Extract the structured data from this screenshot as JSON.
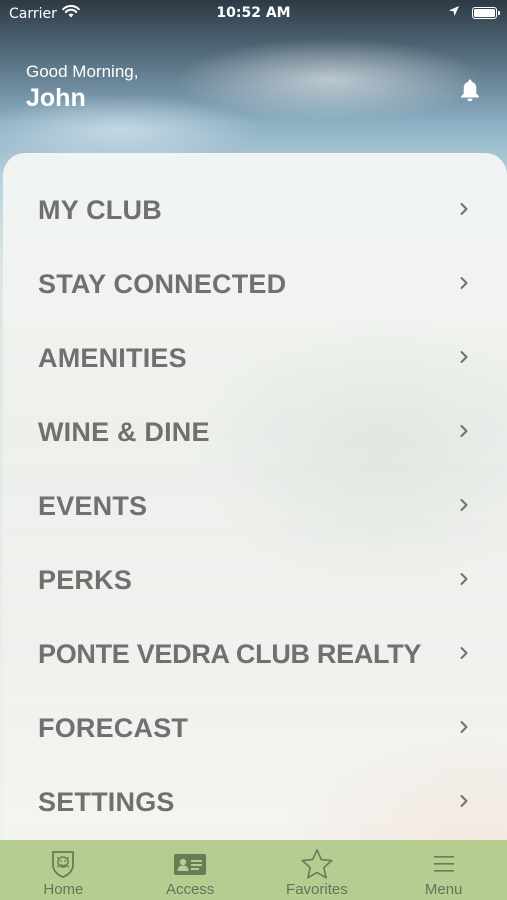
{
  "status_bar": {
    "carrier": "Carrier",
    "time": "10:52 AM"
  },
  "header": {
    "greeting": "Good Morning,",
    "name": "John"
  },
  "menu": {
    "items": [
      {
        "label": "MY CLUB"
      },
      {
        "label": "STAY CONNECTED"
      },
      {
        "label": "AMENITIES"
      },
      {
        "label": "WINE & DINE"
      },
      {
        "label": "EVENTS"
      },
      {
        "label": "PERKS"
      },
      {
        "label": "PONTE VEDRA CLUB REALTY"
      },
      {
        "label": "FORECAST"
      },
      {
        "label": "SETTINGS"
      }
    ]
  },
  "tab_bar": {
    "tabs": [
      {
        "label": "Home",
        "icon": "lion-crest-icon"
      },
      {
        "label": "Access",
        "icon": "member-card-icon"
      },
      {
        "label": "Favorites",
        "icon": "star-icon"
      },
      {
        "label": "Menu",
        "icon": "hamburger-menu-icon"
      }
    ]
  },
  "colors": {
    "tab_bar_bg": "#b6cd92",
    "menu_text": "#707070",
    "header_text": "#ffffff"
  }
}
